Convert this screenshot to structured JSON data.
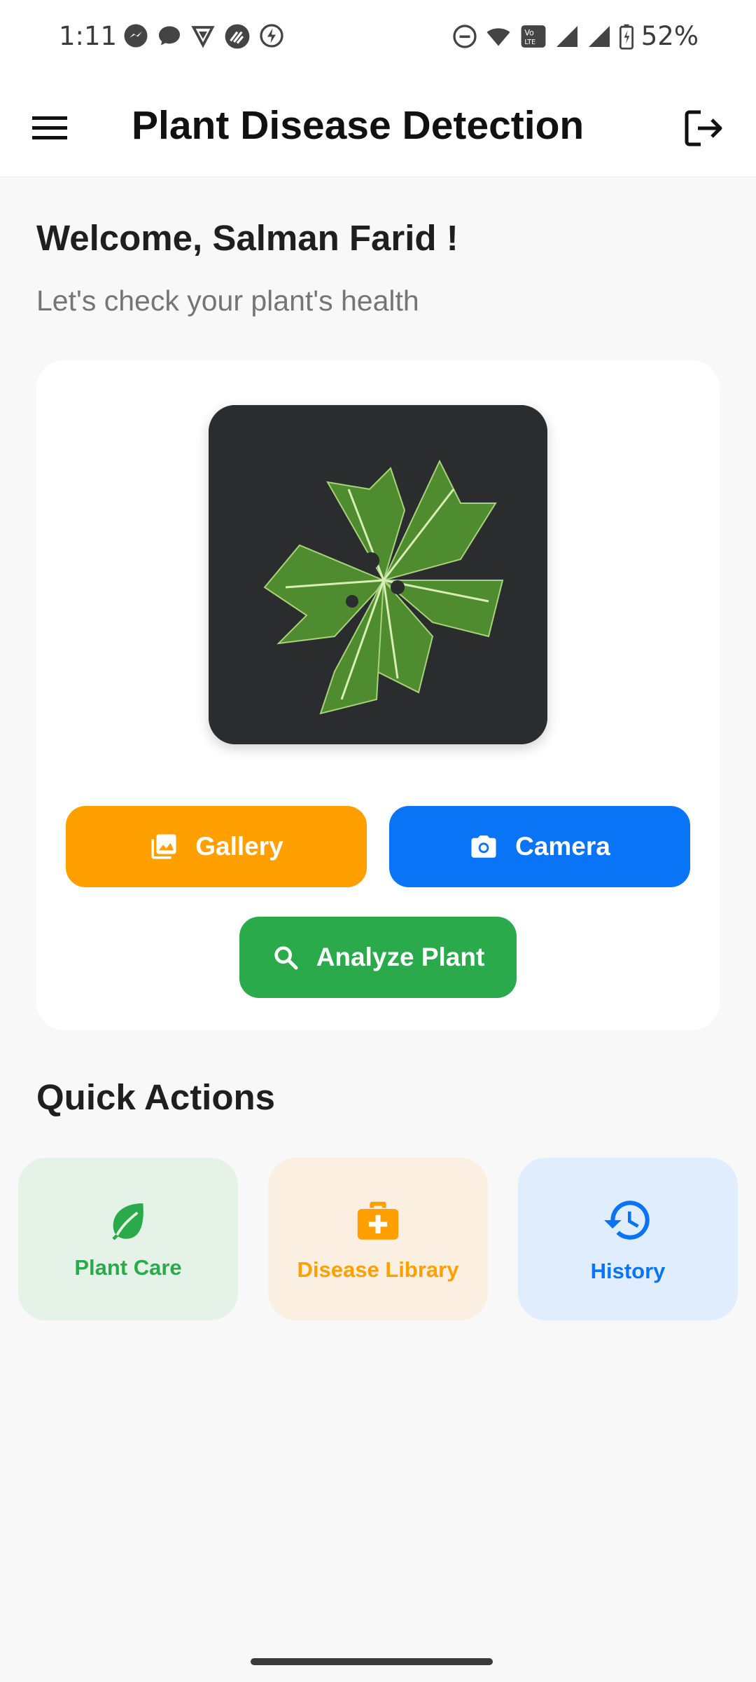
{
  "status_bar": {
    "time": "1:11",
    "battery": "52%",
    "left_icons": [
      "messenger-icon",
      "chat-icon",
      "vpn-icon",
      "app-icon",
      "bolt-icon"
    ],
    "right_icons": [
      "dnd-icon",
      "wifi-icon",
      "volte-icon",
      "signal-icon",
      "signal-icon",
      "battery-charging-icon"
    ]
  },
  "app_bar": {
    "title": "Plant Disease Detection",
    "menu_icon": "menu-icon",
    "logout_icon": "logout-icon"
  },
  "welcome": {
    "title": "Welcome, Salman Farid !",
    "subtitle": "Let's check your plant's health"
  },
  "card": {
    "gallery_label": "Gallery",
    "camera_label": "Camera",
    "analyze_label": "Analyze Plant"
  },
  "quick_actions": {
    "title": "Quick Actions",
    "items": [
      {
        "label": "Plant Care",
        "icon": "leaf-icon",
        "color": "#2AAA4A"
      },
      {
        "label": "Disease Library",
        "icon": "medical-kit-icon",
        "color": "#FFA000"
      },
      {
        "label": "History",
        "icon": "history-icon",
        "color": "#0A74F6"
      }
    ]
  },
  "colors": {
    "gallery": "#FFA000",
    "camera": "#0A74F6",
    "analyze": "#2AAA4A"
  }
}
